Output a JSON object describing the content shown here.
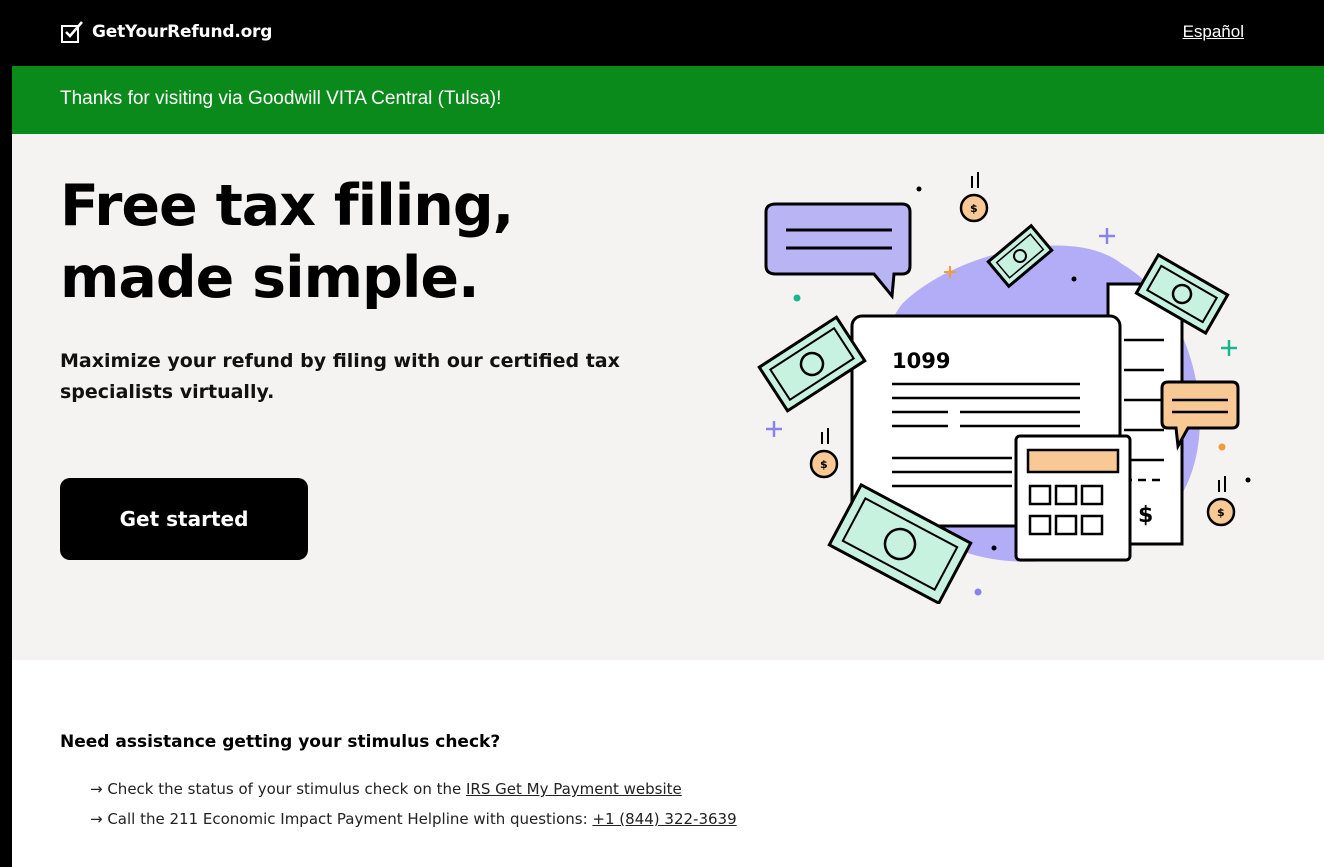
{
  "header": {
    "logo_text": "GetYourRefund.org",
    "language_link": "Español"
  },
  "banner": {
    "text": "Thanks for visiting via Goodwill VITA Central (Tulsa)!"
  },
  "hero": {
    "title": "Free tax filing, made simple.",
    "subtitle": "Maximize your refund by filing with our certified tax specialists virtually.",
    "cta_label": "Get started",
    "illustration": {
      "form_label": "1099",
      "currency_symbol": "$"
    }
  },
  "stimulus": {
    "title": "Need assistance getting your stimulus check?",
    "items": [
      {
        "prefix": "→ Check the status of your stimulus check on the ",
        "link": "IRS Get My Payment website"
      },
      {
        "prefix": "→ Call the 211 Economic Impact Payment Helpline with questions: ",
        "link": "+1 (844) 322-3639"
      }
    ]
  },
  "colors": {
    "banner_green": "#0a8a1a",
    "hero_bg": "#f4f3f1",
    "money_green": "#c8f2e0",
    "speech_purple": "#b9b5f5",
    "speech_orange": "#f8c994",
    "blob_purple": "#b3adf7"
  }
}
